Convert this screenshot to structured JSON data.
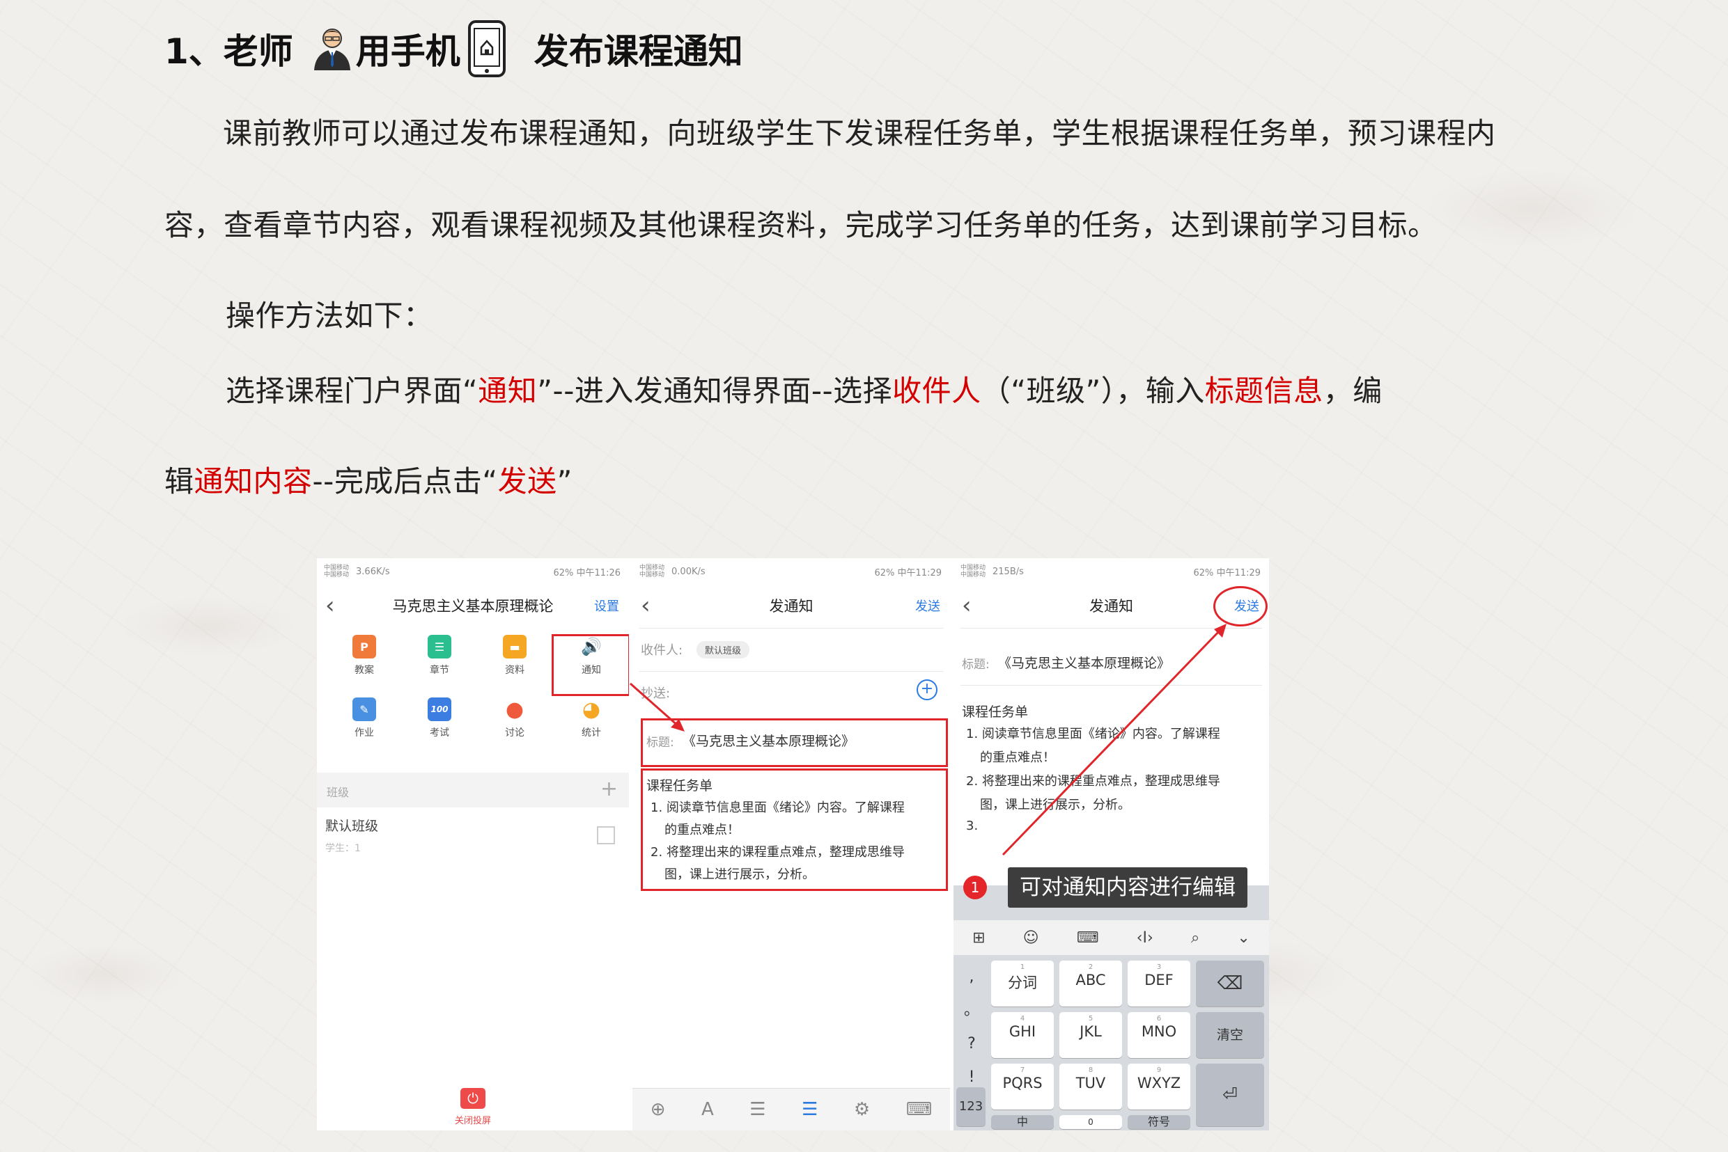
{
  "heading": {
    "part1": "1、老师",
    "part2": "用手机",
    "part3": "发布课程通知"
  },
  "paragraphs": {
    "intro_line1": "课前教师可以通过发布课程通知，向班级学生下发课程任务单，学生根据课程任务单，预习课程内",
    "intro_line2": "容，查看章节内容，观看课程视频及其他课程资料，完成学习任务单的任务，达到课前学习目标。",
    "method_title": "操作方法如下：",
    "steps_line1": {
      "a": "选择课程门户界面“",
      "b": "通知",
      "c": "”--进入发通知得界面--选择",
      "d": "收件人",
      "e": "（“班级”），输入",
      "f": "标题信息",
      "g": "，编"
    },
    "steps_line2": {
      "a": "辑",
      "b": "通知内容",
      "c": "--完成后点击“",
      "d": "发送",
      "e": "”"
    }
  },
  "screen1": {
    "status_left": "3.66K/s",
    "status_carrier": "中国移动\n中国移动",
    "status_right": "62% 中午11:26",
    "title": "马克思主义基本原理概论",
    "settings": "设置",
    "apps": [
      "教案",
      "章节",
      "资料",
      "通知",
      "作业",
      "考试",
      "讨论",
      "统计"
    ],
    "app_glyphs": [
      "P",
      "☰",
      "▬",
      "🔊",
      "✎",
      "100",
      "●",
      "◕"
    ],
    "section": "班级",
    "section_plus": "+",
    "class_name": "默认班级",
    "class_sub": "学生：1",
    "bottom": "关闭投屏"
  },
  "screen2": {
    "status_left": "0.00K/s",
    "status_right": "62% 中午11:29",
    "title": "发通知",
    "send": "发送",
    "recipient_label": "收件人:",
    "recipient_chip": "默认班级",
    "cc_label": "抄送:",
    "subject_label": "标题:",
    "subject": "《马克思主义基本原理概论》",
    "body_title": "课程任务单",
    "body_lines": [
      "1. 阅读章节信息里面《绪论》内容。了解课程",
      "的重点难点！",
      "2. 将整理出来的课程重点难点，整理成思维导",
      "图，课上进行展示，分析。"
    ],
    "toolbar": [
      "⊕",
      "A",
      "☰",
      "☰",
      "⚙",
      "⌨"
    ]
  },
  "screen3": {
    "status_left": "215B/s",
    "status_right": "62% 中午11:29",
    "title": "发通知",
    "send": "发送",
    "subject_label": "标题:",
    "subject": "《马克思主义基本原理概论》",
    "body_title": "课程任务单",
    "body_lines": [
      "1. 阅读章节信息里面《绪论》内容。了解课程",
      "的重点难点！",
      "2. 将整理出来的课程重点难点，整理成思维导",
      "图，课上进行展示，分析。",
      "3."
    ],
    "badge": "1",
    "tooltip": "可对通知内容进行编辑",
    "kbd_tools": [
      "⊞",
      "☺",
      "⌨",
      "‹I›",
      "⌕",
      "⌄"
    ],
    "side_keys": [
      ",",
      "。",
      "?",
      "!"
    ],
    "keys": [
      {
        "num": "1",
        "label": "分词"
      },
      {
        "num": "2",
        "label": "ABC"
      },
      {
        "num": "3",
        "label": "DEF"
      },
      {
        "num": "4",
        "label": "GHI"
      },
      {
        "num": "5",
        "label": "JKL"
      },
      {
        "num": "6",
        "label": "MNO"
      },
      {
        "num": "7",
        "label": "PQRS"
      },
      {
        "num": "8",
        "label": "TUV"
      },
      {
        "num": "9",
        "label": "WXYZ"
      }
    ],
    "delete_key": "⌫",
    "clear_key": "清空",
    "enter_key": "⏎",
    "bottom_keys": [
      "123",
      "中",
      "0",
      "符号"
    ]
  },
  "colors": {
    "accent_red": "#d40000",
    "link_blue": "#2a7ae2"
  }
}
